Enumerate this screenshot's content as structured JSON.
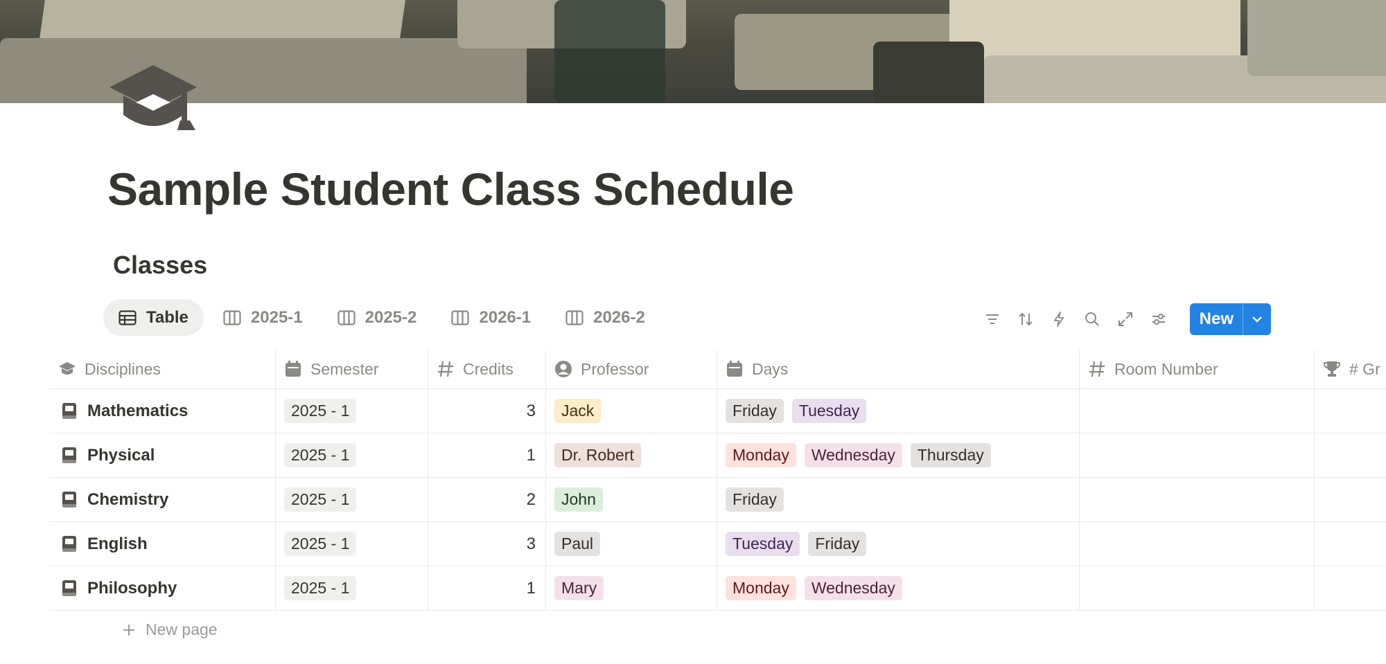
{
  "page": {
    "title": "Sample Student Class Schedule",
    "icon": "graduation-cap-icon"
  },
  "database": {
    "title": "Classes",
    "tabs": [
      {
        "label": "Table",
        "icon": "table-icon",
        "active": true
      },
      {
        "label": "2025-1",
        "icon": "board-icon",
        "active": false
      },
      {
        "label": "2025-2",
        "icon": "board-icon",
        "active": false
      },
      {
        "label": "2026-1",
        "icon": "board-icon",
        "active": false
      },
      {
        "label": "2026-2",
        "icon": "board-icon",
        "active": false
      }
    ],
    "toolbar": {
      "icons": [
        "filter-icon",
        "sort-icon",
        "automation-icon",
        "search-icon",
        "expand-icon",
        "settings-icon"
      ],
      "new_label": "New"
    },
    "columns": [
      {
        "label": "Disciplines",
        "icon": "graduation-cap-icon"
      },
      {
        "label": "Semester",
        "icon": "calendar-icon"
      },
      {
        "label": "Credits",
        "icon": "number-icon"
      },
      {
        "label": "Professor",
        "icon": "person-icon"
      },
      {
        "label": "Days",
        "icon": "calendar-icon"
      },
      {
        "label": "Room Number",
        "icon": "number-icon"
      },
      {
        "label": "# Gr",
        "icon": "trophy-icon"
      }
    ],
    "rows": [
      {
        "discipline": "Mathematics",
        "semester": "2025 - 1",
        "credits": "3",
        "professor": "Jack",
        "days": [
          "Friday",
          "Tuesday"
        ]
      },
      {
        "discipline": "Physical",
        "semester": "2025 - 1",
        "credits": "1",
        "professor": "Dr. Robert",
        "days": [
          "Monday",
          "Wednesday",
          "Thursday"
        ]
      },
      {
        "discipline": "Chemistry",
        "semester": "2025 - 1",
        "credits": "2",
        "professor": "John",
        "days": [
          "Friday"
        ]
      },
      {
        "discipline": "English",
        "semester": "2025 - 1",
        "credits": "3",
        "professor": "Paul",
        "days": [
          "Tuesday",
          "Friday"
        ]
      },
      {
        "discipline": "Philosophy",
        "semester": "2025 - 1",
        "credits": "1",
        "professor": "Mary",
        "days": [
          "Monday",
          "Wednesday"
        ]
      }
    ],
    "new_page_label": "New page"
  },
  "colors": {
    "accent": "#2383e2",
    "days": {
      "Monday": "red",
      "Tuesday": "purple",
      "Wednesday": "pink",
      "Thursday": "gray",
      "Friday": "gray"
    },
    "professors": {
      "Jack": "yellow",
      "Dr. Robert": "brown",
      "John": "green",
      "Paul": "gray",
      "Mary": "pink"
    }
  }
}
